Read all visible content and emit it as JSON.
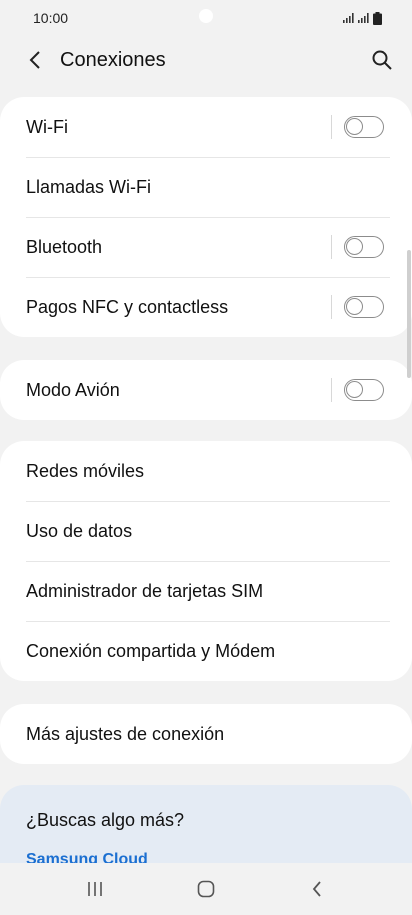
{
  "status_bar": {
    "time": "10:00"
  },
  "header": {
    "title": "Conexiones"
  },
  "groups": [
    {
      "rows": [
        {
          "label": "Wi-Fi",
          "toggle": true,
          "on": false
        },
        {
          "label": "Llamadas Wi-Fi",
          "toggle": false
        },
        {
          "label": "Bluetooth",
          "toggle": true,
          "on": false
        },
        {
          "label": "Pagos NFC y contactless",
          "toggle": true,
          "on": false
        }
      ]
    },
    {
      "rows": [
        {
          "label": "Modo Avión",
          "toggle": true,
          "on": false
        }
      ]
    },
    {
      "rows": [
        {
          "label": "Redes móviles",
          "toggle": false
        },
        {
          "label": "Uso de datos",
          "toggle": false
        },
        {
          "label": "Administrador de tarjetas SIM",
          "toggle": false
        },
        {
          "label": "Conexión compartida y Módem",
          "toggle": false
        }
      ]
    },
    {
      "rows": [
        {
          "label": "Más ajustes de conexión",
          "toggle": false
        }
      ]
    }
  ],
  "suggestions": {
    "title": "¿Buscas algo más?",
    "link": "Samsung Cloud"
  },
  "colors": {
    "background": "#f2f2f2",
    "card": "#ffffff",
    "suggest_bg": "#e4ebf4",
    "link": "#1b6fd1",
    "toggle_off": "#8c8c8c"
  }
}
